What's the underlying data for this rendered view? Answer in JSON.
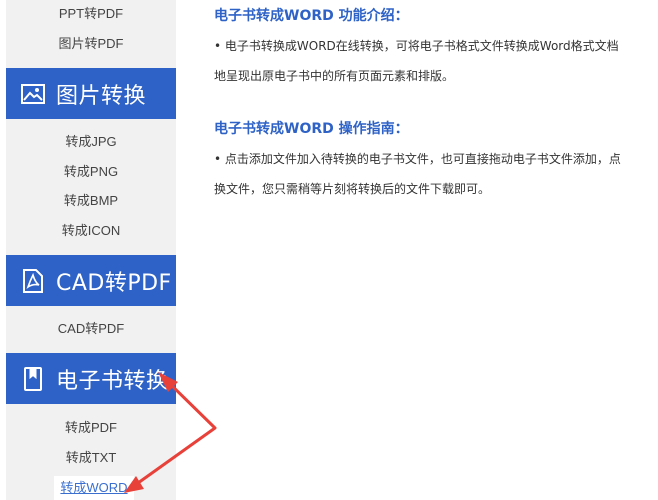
{
  "sidebar": {
    "top_links": [
      "PPT转PDF",
      "图片转PDF"
    ],
    "image_section": {
      "header": "图片转换",
      "icon": "image-icon",
      "links": [
        "转成JPG",
        "转成PNG",
        "转成BMP",
        "转成ICON"
      ]
    },
    "cad_section": {
      "header": "CAD转PDF",
      "icon": "pdf-file-icon",
      "links": [
        "CAD转PDF"
      ]
    },
    "ebook_section": {
      "header": "电子书转换",
      "icon": "book-icon",
      "links": [
        "转成PDF",
        "转成TXT",
        "转成WORD"
      ],
      "active_link": "转成WORD"
    }
  },
  "main": {
    "intro_title": "电子书转成WORD 功能介绍：",
    "intro_line1": "• 电子书转换成WORD在线转换，可将电子书格式文件转换成Word格式文档",
    "intro_line2": "地呈现出原电子书中的所有页面元素和排版。",
    "guide_title": "电子书转成WORD 操作指南：",
    "guide_line1": "• 点击添加文件加入待转换的电子书文件，也可直接拖动电子书文件添加，点",
    "guide_line2": "换文件，您只需稍等片刻将转换后的文件下载即可。"
  },
  "colors": {
    "accent": "#2e62c6",
    "sidebar_bg": "#f1f1f1",
    "annotation_arrow": "#e8413a"
  }
}
